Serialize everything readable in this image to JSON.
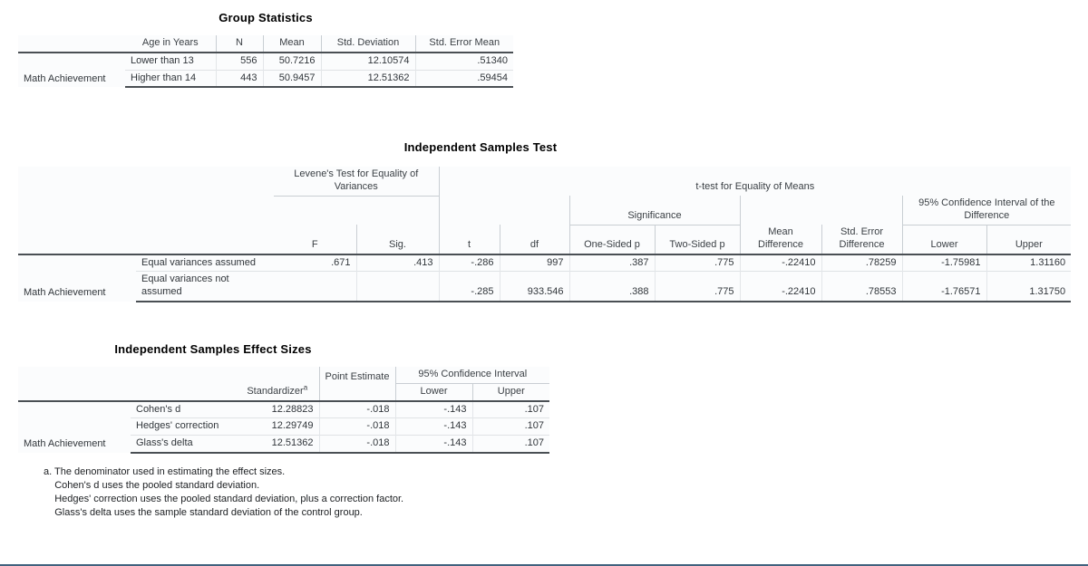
{
  "document": {
    "type": "spss-output",
    "accent_rule_color": "#41627e",
    "stub_shade_color": "#dcdcdc",
    "stub_cat_shade_color": "#e8e8e8"
  },
  "group_statistics": {
    "title": "Group Statistics",
    "stub_header": "Age in Years",
    "columns": [
      "N",
      "Mean",
      "Std. Deviation",
      "Std. Error Mean"
    ],
    "variable_label": "Math Achievement",
    "rows": [
      {
        "category": "Lower than 13",
        "n": "556",
        "mean": "50.7216",
        "sd": "12.10574",
        "se_mean": ".51340"
      },
      {
        "category": "Higher than 14",
        "n": "443",
        "mean": "50.9457",
        "sd": "12.51362",
        "se_mean": ".59454"
      }
    ]
  },
  "independent_samples_test": {
    "title": "Independent Samples Test",
    "group_levene": "Levene's Test for Equality of Variances",
    "group_ttest": "t-test for Equality of Means",
    "group_significance": "Significance",
    "group_ci": "95% Confidence Interval of the Difference",
    "columns": {
      "f": "F",
      "sig": "Sig.",
      "t": "t",
      "df": "df",
      "one_sided_p": "One-Sided p",
      "two_sided_p": "Two-Sided p",
      "mean_difference": "Mean Difference",
      "std_error_difference": "Std. Error Difference",
      "ci_lower": "Lower",
      "ci_upper": "Upper"
    },
    "variable_label": "Math Achievement",
    "rows": [
      {
        "category": "Equal variances assumed",
        "f": ".671",
        "sig": ".413",
        "t": "-.286",
        "df": "997",
        "one_sided_p": ".387",
        "two_sided_p": ".775",
        "mean_difference": "-.22410",
        "std_error_difference": ".78259",
        "ci_lower": "-1.75981",
        "ci_upper": "1.31160"
      },
      {
        "category": "Equal variances not assumed",
        "f": "",
        "sig": "",
        "t": "-.285",
        "df": "933.546",
        "one_sided_p": ".388",
        "two_sided_p": ".775",
        "mean_difference": "-.22410",
        "std_error_difference": ".78553",
        "ci_lower": "-1.76571",
        "ci_upper": "1.31750"
      }
    ]
  },
  "effect_sizes": {
    "title": "Independent Samples Effect Sizes",
    "group_ci": "95% Confidence Interval",
    "columns": {
      "standardizer": "Standardizer",
      "standardizer_footnote": "a",
      "point_estimate": "Point Estimate",
      "ci_lower": "Lower",
      "ci_upper": "Upper"
    },
    "variable_label": "Math Achievement",
    "rows": [
      {
        "measure": "Cohen's d",
        "standardizer": "12.28823",
        "point_estimate": "-.018",
        "ci_lower": "-.143",
        "ci_upper": ".107"
      },
      {
        "measure": "Hedges' correction",
        "standardizer": "12.29749",
        "point_estimate": "-.018",
        "ci_lower": "-.143",
        "ci_upper": ".107"
      },
      {
        "measure": "Glass's delta",
        "standardizer": "12.51362",
        "point_estimate": "-.018",
        "ci_lower": "-.143",
        "ci_upper": ".107"
      }
    ],
    "footnote": "a. The denominator used in estimating the effect sizes.\n    Cohen's d uses the pooled standard deviation.\n    Hedges' correction uses the pooled standard deviation, plus a correction factor.\n    Glass's delta uses the sample standard deviation of the control group."
  }
}
